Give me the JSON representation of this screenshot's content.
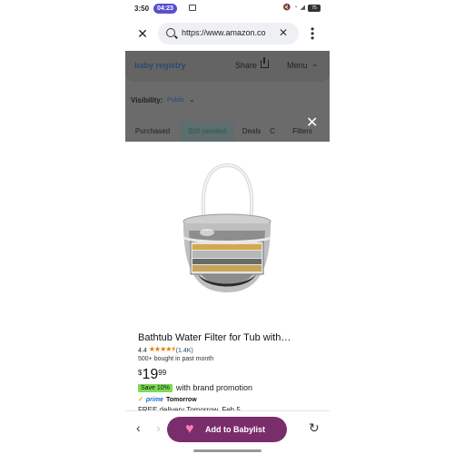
{
  "status_bar": {
    "time": "3:50",
    "timer": "04:23",
    "battery": "75"
  },
  "browser": {
    "url": "https://www.amazon.co"
  },
  "registry_header": {
    "title": "baby registry",
    "share_label": "Share",
    "menu_label": "Menu"
  },
  "visibility": {
    "label": "Visibility:",
    "value": "Public"
  },
  "tabs": [
    {
      "label": "Purchased"
    },
    {
      "label": "Still needed"
    },
    {
      "label": "Deals"
    },
    {
      "label": "C"
    },
    {
      "label": "Filters"
    }
  ],
  "product": {
    "title": "Bathtub Water Filter for Tub with…",
    "rating": "4.4",
    "stars_count": 4.5,
    "rating_count": "(1.4K)",
    "bought": "500+ bought in past month",
    "price_currency": "$",
    "price_whole": "19",
    "price_fraction": "99",
    "save_badge": "Save 10%",
    "promo_text": "with brand promotion",
    "prime_label": "prime",
    "prime_day": "Tomorrow",
    "delivery_text": "FREE delivery Tomorrow, Feb 5"
  },
  "bottom_bar": {
    "add_label": "Add to Babylist"
  },
  "colors": {
    "accent": "#7a2d6b",
    "overlay": "#6b6b6b",
    "save_badge": "#7ed957"
  },
  "icons": [
    "close-icon",
    "search-icon",
    "clear-icon",
    "more-vert-icon",
    "share-icon",
    "chevron-down-icon",
    "overlay-close-icon",
    "heart-icon",
    "back-icon",
    "forward-icon",
    "reload-icon"
  ]
}
